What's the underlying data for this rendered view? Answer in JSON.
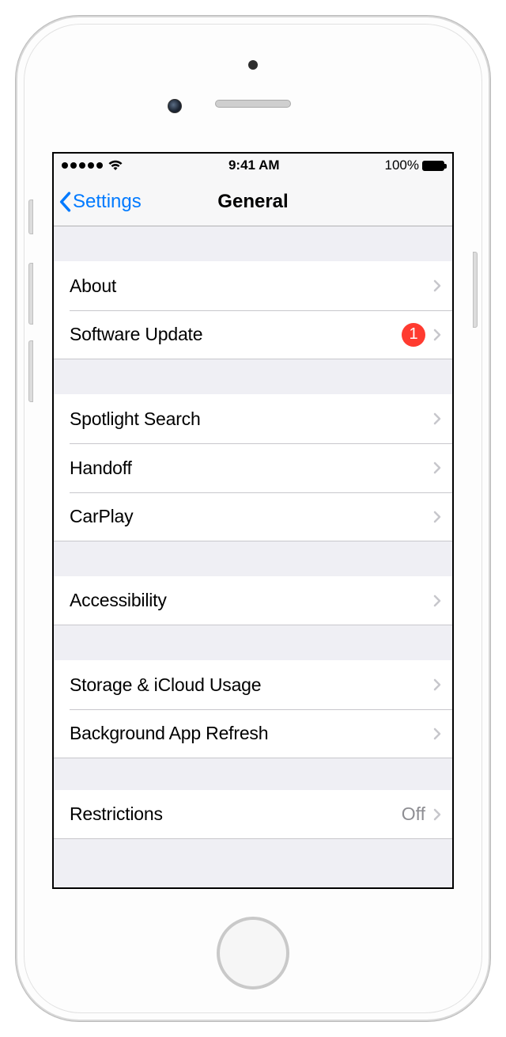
{
  "status": {
    "time": "9:41 AM",
    "battery_pct": "100%"
  },
  "nav": {
    "back_label": "Settings",
    "title": "General"
  },
  "cells": {
    "about": "About",
    "software_update": "Software Update",
    "software_update_badge": "1",
    "spotlight": "Spotlight Search",
    "handoff": "Handoff",
    "carplay": "CarPlay",
    "accessibility": "Accessibility",
    "storage": "Storage & iCloud Usage",
    "background_refresh": "Background App Refresh",
    "restrictions": "Restrictions",
    "restrictions_value": "Off"
  },
  "colors": {
    "tint": "#007aff",
    "badge": "#ff3b30",
    "bg_grouped": "#efeff4",
    "separator": "#c8c7cc",
    "secondary_text": "#8e8e93"
  }
}
